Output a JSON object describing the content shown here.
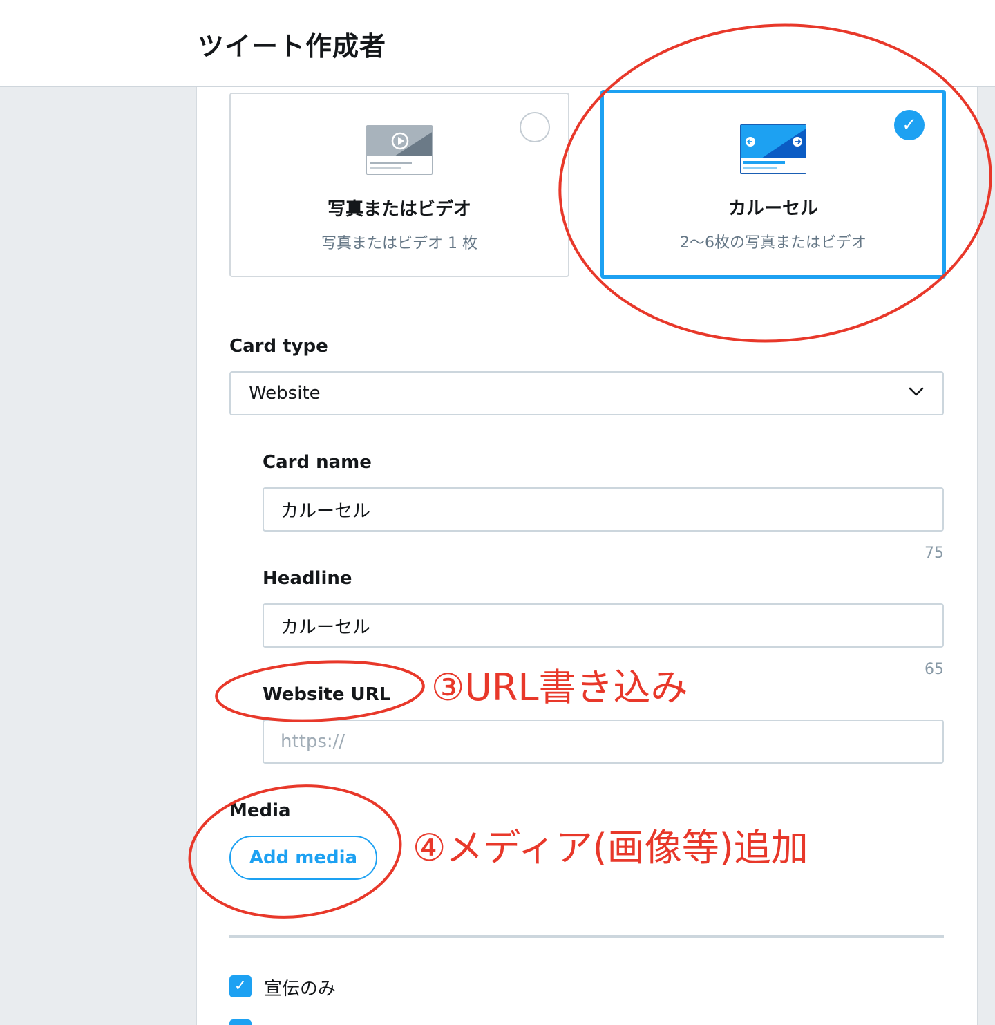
{
  "header": {
    "title": "ツイート作成者"
  },
  "formats": [
    {
      "title": "写真またはビデオ",
      "subtitle": "写真またはビデオ 1 枚",
      "selected": false
    },
    {
      "title": "カルーセル",
      "subtitle": "2〜6枚の写真またはビデオ",
      "selected": true
    }
  ],
  "card_type": {
    "label": "Card type",
    "value": "Website"
  },
  "card_name": {
    "label": "Card name",
    "value": "カルーセル",
    "counter": "75"
  },
  "headline": {
    "label": "Headline",
    "value": "カルーセル",
    "counter": "65"
  },
  "website_url": {
    "label": "Website URL",
    "placeholder": "https://"
  },
  "media": {
    "label": "Media",
    "button": "Add media"
  },
  "promoted_only": {
    "label": "宣伝のみ",
    "checked": true
  },
  "annotations": {
    "step3": "③URL書き込み",
    "step4": "④メディア(画像等)追加",
    "color": "#e8382a"
  },
  "colors": {
    "accent": "#1da1f2",
    "panel_bg": "#e9ecef"
  },
  "icons": {
    "check": "✓",
    "chevron": "chevron-down-icon"
  }
}
